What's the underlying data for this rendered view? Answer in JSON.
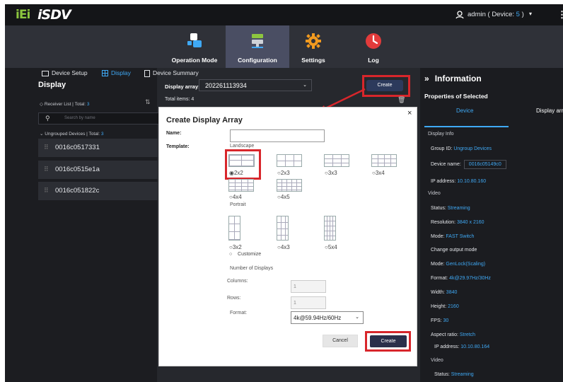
{
  "brand": {
    "logo_mark": "iEi",
    "logo_text": "iSDV"
  },
  "topbar": {
    "user_text": "admin ( Device:",
    "user_count": "5",
    "user_close": " )",
    "icons": {
      "user": "user-icon",
      "caret": "caret-down-icon",
      "menu": "kebab-menu-icon"
    }
  },
  "nav": [
    {
      "label": "Operation Mode",
      "icon": "operation-mode-icon"
    },
    {
      "label": "Configuration",
      "icon": "configuration-icon",
      "active": true
    },
    {
      "label": "Settings",
      "icon": "gear-icon"
    },
    {
      "label": "Log",
      "icon": "log-clock-icon"
    }
  ],
  "left": {
    "tabs": [
      "Device Setup",
      "Display",
      "Device Summary"
    ],
    "title": "Display",
    "receiver_label": "Receiver List | Total:",
    "receiver_total": "3",
    "search_placeholder": "Search by name",
    "ungrouped_label": "Ungrouped Devices | Total:",
    "ungrouped_total": "3",
    "devices": [
      "0016c0517331",
      "0016c0515e1a",
      "0016c051822c"
    ]
  },
  "center": {
    "display_array_label": "Display array:",
    "display_array_value": "202261113934",
    "total_items": "Total items: 4",
    "create_label": "Create"
  },
  "right": {
    "title": "Information",
    "props_label": "Properties of Selected",
    "tab_device": "Device",
    "tab_display": "Display array",
    "display_info": "Display Info",
    "group_id_label": "Group ID:",
    "group_id": "Ungroup Devices",
    "device_name_label": "Device name:",
    "device_name": "0016c05149c0",
    "ip_label": "IP address:",
    "ip": "10.10.80.160",
    "video": "Video",
    "status_label": "Status:",
    "status": "Streaming",
    "resolution_label": "Resolution:",
    "resolution": "3840 x 2160",
    "mode_label": "Mode:",
    "mode": "FAST Switch",
    "change_mode": "Change output mode",
    "mode2_label": "Mode:",
    "mode2": "GenLock(Scaling)",
    "format_label": "Format:",
    "format": "4k@29.97Hz/30Hz",
    "width_label": "Width:",
    "width": "3840",
    "height_label": "Height:",
    "height": "2160",
    "fps_label": "FPS:",
    "fps": "30",
    "aspect_label": "Aspect ratio:",
    "aspect": "Stretch",
    "ip2_label": "IP address:",
    "ip2": "10.10.80.164",
    "video2": "Video",
    "status2_label": "Status:",
    "status2": "Streaming"
  },
  "modal": {
    "title": "Create Display Array",
    "close": "×",
    "name_label": "Name:",
    "template_label": "Template:",
    "landscape": "Landscape",
    "portrait": "Portrait",
    "landscape_options": [
      "2x2",
      "2x3",
      "3x3",
      "3x4",
      "4x4",
      "4x5"
    ],
    "portrait_options": [
      "3x2",
      "4x3",
      "5x4"
    ],
    "customize": "Customize",
    "num_displays": "Number of Displays",
    "columns_label": "Columns:",
    "columns_value": "1",
    "rows_label": "Rows:",
    "rows_value": "1",
    "format_label": "Format:",
    "format_value": "4k@59.94Hz/60Hz",
    "cancel": "Cancel",
    "create": "Create"
  },
  "colors": {
    "accent": "#3fa9f5",
    "highlight": "#d8262b",
    "active_nav": "#4a4e63"
  }
}
